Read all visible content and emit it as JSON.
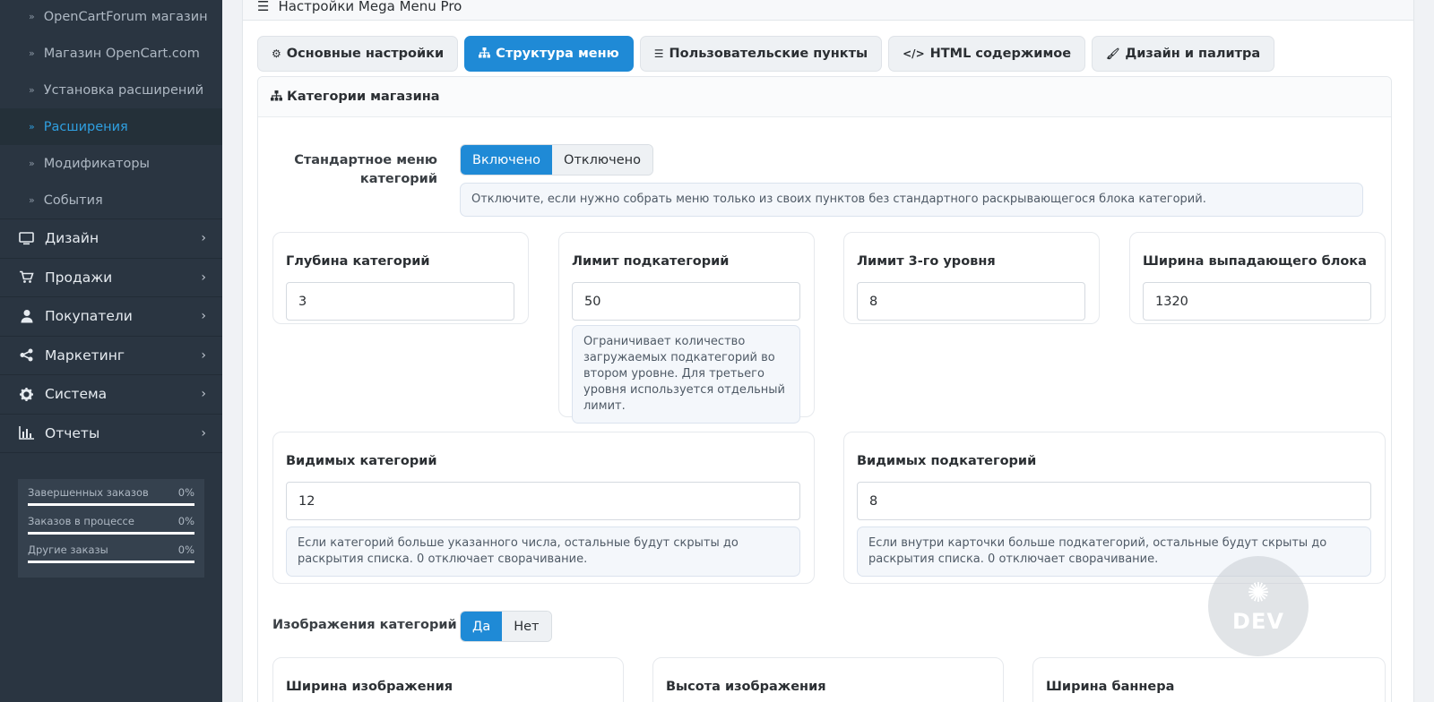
{
  "sidebar": {
    "sub_items": [
      {
        "label": "OpenCartForum магазин",
        "active": false
      },
      {
        "label": "Магазин OpenCart.com",
        "active": false
      },
      {
        "label": "Установка расширений",
        "active": false
      },
      {
        "label": "Расширения",
        "active": true
      },
      {
        "label": "Модификаторы",
        "active": false
      },
      {
        "label": "События",
        "active": false
      }
    ],
    "nav": [
      {
        "label": "Дизайн",
        "icon": "monitor-icon"
      },
      {
        "label": "Продажи",
        "icon": "cart-icon"
      },
      {
        "label": "Покупатели",
        "icon": "user-icon"
      },
      {
        "label": "Маркетинг",
        "icon": "share-icon"
      },
      {
        "label": "Система",
        "icon": "gear-icon"
      },
      {
        "label": "Отчеты",
        "icon": "bar-chart-icon"
      }
    ],
    "stats": [
      {
        "label": "Завершенных заказов",
        "value": "0%",
        "progress": 1.0
      },
      {
        "label": "Заказов в процессе",
        "value": "0%",
        "progress": 1.0
      },
      {
        "label": "Другие заказы",
        "value": "0%",
        "progress": 1.0
      }
    ]
  },
  "panel": {
    "title": "Настройки Mega Menu Pro"
  },
  "tabs": [
    {
      "label": "Основные настройки",
      "icon": "gears-icon"
    },
    {
      "label": "Структура меню",
      "icon": "sitemap-icon"
    },
    {
      "label": "Пользовательские пункты",
      "icon": "list-icon"
    },
    {
      "label": "HTML содержимое",
      "icon": "code-icon"
    },
    {
      "label": "Дизайн и палитра",
      "icon": "brush-icon"
    }
  ],
  "section": {
    "title": "Категории магазина",
    "standard_menu": {
      "label": "Стандартное меню категорий",
      "options": [
        "Включено",
        "Отключено"
      ],
      "selected": "Включено",
      "hint": "Отключите, если нужно собрать меню только из своих пунктов без стандартного раскрывающегося блока категорий."
    },
    "fields": {
      "depth": {
        "label": "Глубина категорий",
        "value": "3"
      },
      "sub_limit": {
        "label": "Лимит подкатегорий",
        "value": "50",
        "hint": "Ограничивает количество загружаемых подкатегорий во втором уровне. Для третьего уровня используется отдельный лимит."
      },
      "level3_limit": {
        "label": "Лимит 3-го уровня",
        "value": "8"
      },
      "dropdown_width": {
        "label": "Ширина выпадающего блока",
        "value": "1320"
      },
      "visible_categories": {
        "label": "Видимых категорий",
        "value": "12",
        "hint": "Если категорий больше указанного числа, остальные будут скрыты до раскрытия списка. 0 отключает сворачивание."
      },
      "visible_subcategories": {
        "label": "Видимых подкатегорий",
        "value": "8",
        "hint": "Если внутри карточки больше подкатегорий, остальные будут скрыты до раскрытия списка. 0 отключает сворачивание."
      }
    },
    "images": {
      "label": "Изображения категорий",
      "options": [
        "Да",
        "Нет"
      ],
      "selected": "Да"
    },
    "bottom_fields": [
      "Ширина изображения",
      "Высота изображения",
      "Ширина баннера"
    ]
  },
  "watermark": {
    "text": "DEV"
  },
  "colors": {
    "accent": "#1f8ad6",
    "sidebar_bg": "#2a3541",
    "active_link": "#2f9fe0"
  }
}
